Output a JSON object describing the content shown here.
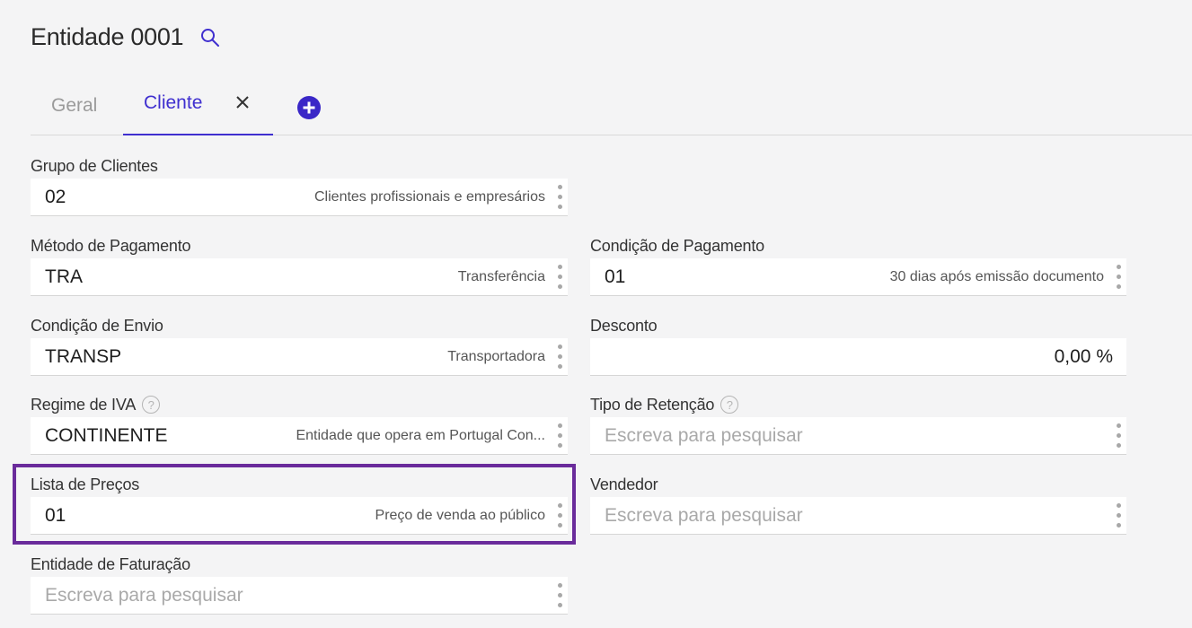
{
  "header": {
    "title": "Entidade 0001",
    "search_icon": "search-icon"
  },
  "tabs": [
    {
      "label": "Geral",
      "active": false
    },
    {
      "label": "Cliente",
      "active": true
    }
  ],
  "colors": {
    "accent": "#3f2fcf",
    "highlight": "#6a2b9b"
  },
  "fields": {
    "grupo_clientes": {
      "label": "Grupo de Clientes",
      "value": "02",
      "desc": "Clientes profissionais e empresários"
    },
    "metodo_pagamento": {
      "label": "Método de Pagamento",
      "value": "TRA",
      "desc": "Transferência"
    },
    "condicao_pagamento": {
      "label": "Condição de Pagamento",
      "value": "01",
      "desc": "30 dias após emissão documento"
    },
    "condicao_envio": {
      "label": "Condição de Envio",
      "value": "TRANSP",
      "desc": "Transportadora"
    },
    "desconto": {
      "label": "Desconto",
      "value": "0,00 %"
    },
    "regime_iva": {
      "label": "Regime de IVA",
      "value": "CONTINENTE",
      "desc": "Entidade que opera em Portugal Con..."
    },
    "tipo_retencao": {
      "label": "Tipo de Retenção",
      "placeholder": "Escreva para pesquisar"
    },
    "lista_precos": {
      "label": "Lista de Preços",
      "value": "01",
      "desc": "Preço de venda ao público"
    },
    "vendedor": {
      "label": "Vendedor",
      "placeholder": "Escreva para pesquisar"
    },
    "entidade_faturacao": {
      "label": "Entidade de Faturação",
      "placeholder": "Escreva para pesquisar"
    }
  }
}
